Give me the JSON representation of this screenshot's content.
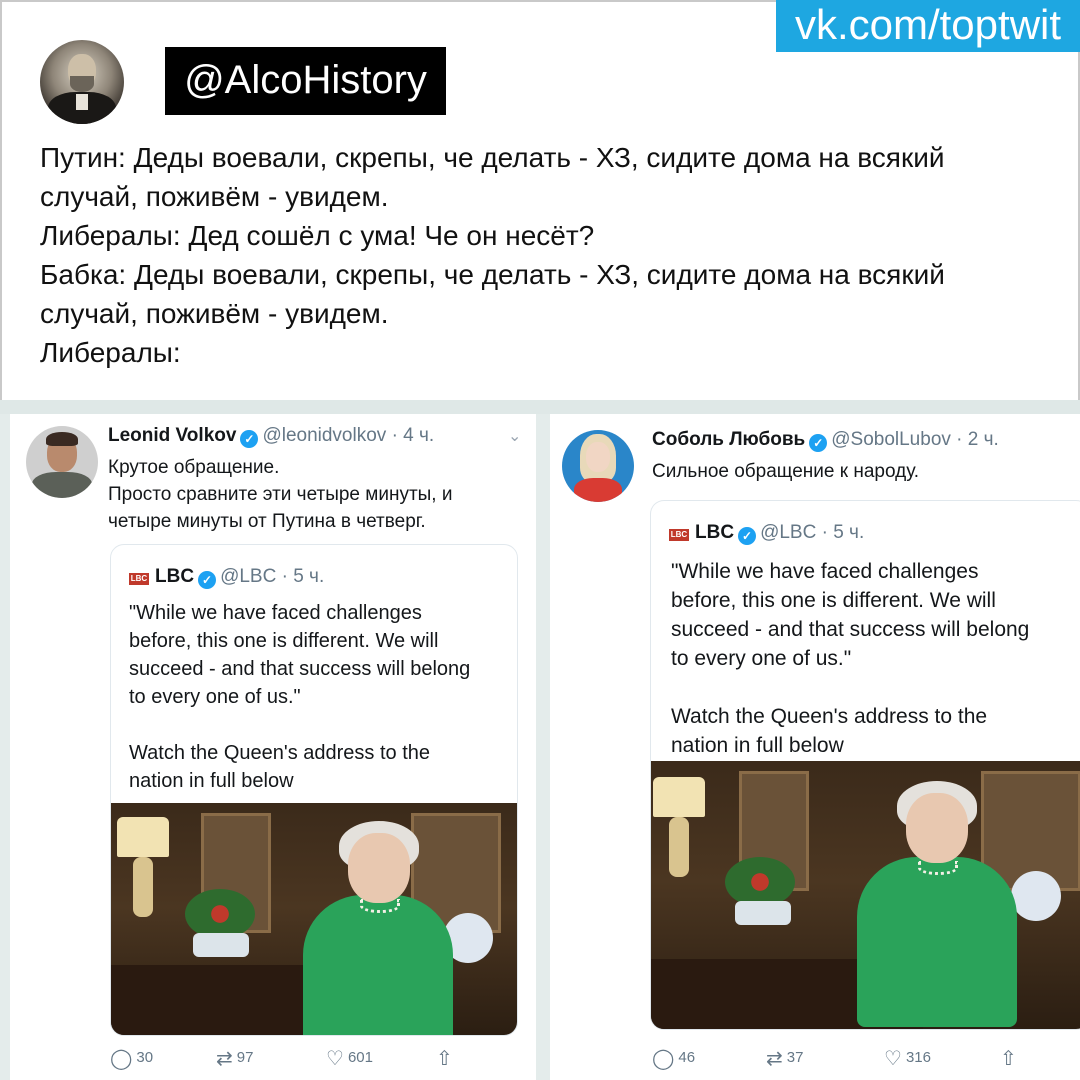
{
  "watermark": "vk.com/toptwit",
  "post": {
    "author_handle": "@AlcoHistory",
    "lines": [
      "Путин: Деды воевали, скрепы, че делать - ХЗ, сидите дома на всякий",
      "случай, поживём - увидем.",
      "Либералы: Дед сошёл с ума! Че он несёт?",
      "Бабка: Деды воевали, скрепы, че делать - ХЗ, сидите дома на всякий",
      "случай, поживём - увидем.",
      "Либералы:"
    ]
  },
  "tweets": [
    {
      "name": "Leonid Volkov",
      "handle": "@leonidvolkov",
      "time": "· 4 ч.",
      "text_lines": [
        "Крутое обращение.",
        "Просто сравните эти четыре минуты, и",
        "четыре минуты от Путина в четверг."
      ],
      "quote": {
        "name": "LBC",
        "handle": "@LBC",
        "time": "· 5 ч.",
        "logo_text": "LBC",
        "text_lines": [
          "\"While we have faced challenges",
          "before, this one is different. We will",
          "succeed - and that success will belong",
          "to every one of us.\"",
          "",
          "Watch the Queen's address to the",
          "nation in full below"
        ]
      },
      "actions": {
        "replies": "30",
        "retweets": "97",
        "likes": "601"
      }
    },
    {
      "name": "Соболь Любовь",
      "handle": "@SobolLubov",
      "time": "· 2 ч.",
      "text_lines": [
        "Сильное обращение к народу."
      ],
      "quote": {
        "name": "LBC",
        "handle": "@LBC",
        "time": "· 5 ч.",
        "logo_text": "LBC",
        "text_lines": [
          "\"While we have faced challenges",
          "before, this one is different. We will",
          "succeed - and that success will belong",
          "to every one of us.\"",
          "",
          "Watch the Queen's address to the",
          "nation in full below"
        ]
      },
      "actions": {
        "replies": "46",
        "retweets": "37",
        "likes": "316"
      }
    }
  ],
  "icons": {
    "verified": "✓",
    "chevron": "⌄",
    "reply": "◯",
    "retweet": "⇄",
    "like": "♡",
    "share": "⇧"
  },
  "colors": {
    "watermark_bg": "#1ea7e1",
    "handle_box_bg": "#000000",
    "verified_blue": "#1da1f2",
    "dress_green": "#2aa35a"
  }
}
